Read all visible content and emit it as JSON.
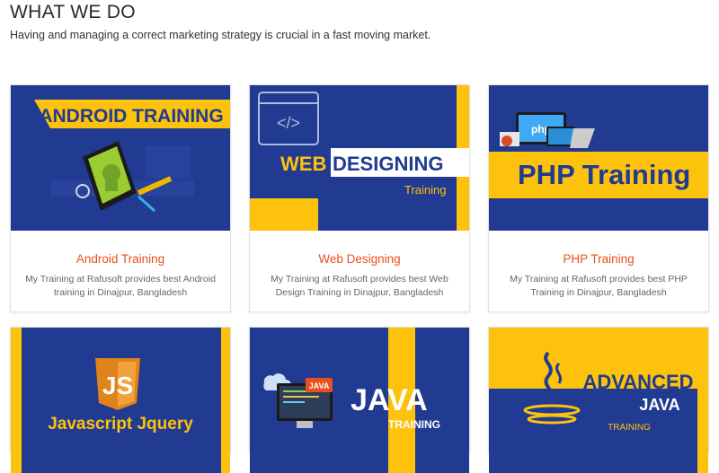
{
  "page": {
    "title": "WHAT WE DO",
    "subtitle": "Having and managing a correct marketing strategy is crucial in a fast moving market."
  },
  "cards": [
    {
      "title": "Android Training",
      "description": "My Training at Rafusoft provides best Android training in Dinajpur, Bangladesh",
      "banner": "ANDROID TRAINING",
      "icon": "android-phone-icon"
    },
    {
      "title": "Web Designing",
      "description": "My Training at Rafusoft provides best Web Design Training in Dinajpur, Bangladesh",
      "banner_a": "WEB",
      "banner_b": "DESIGNING",
      "banner_sub": "Training",
      "icon": "code-window-icon"
    },
    {
      "title": "PHP Training",
      "description": "My Training at Rafusoft provides best PHP Training in Dinajpur, Bangladesh",
      "banner": "PHP Training",
      "icon_label": "php",
      "icon": "php-devices-icon"
    },
    {
      "banner": "Javascript Jquery",
      "icon_label": "JS",
      "icon": "js-shield-icon"
    },
    {
      "banner": "JAVA",
      "banner_sub": "TRAINING",
      "icon_label": "JAVA",
      "icon": "java-computer-icon"
    },
    {
      "banner_a": "ADVANCED",
      "banner_b": "JAVA",
      "banner_sub": "TRAINING",
      "icon": "java-cup-icon"
    }
  ],
  "colors": {
    "navy": "#213a92",
    "yellow": "#fdc20b",
    "accent": "#e8501e"
  }
}
